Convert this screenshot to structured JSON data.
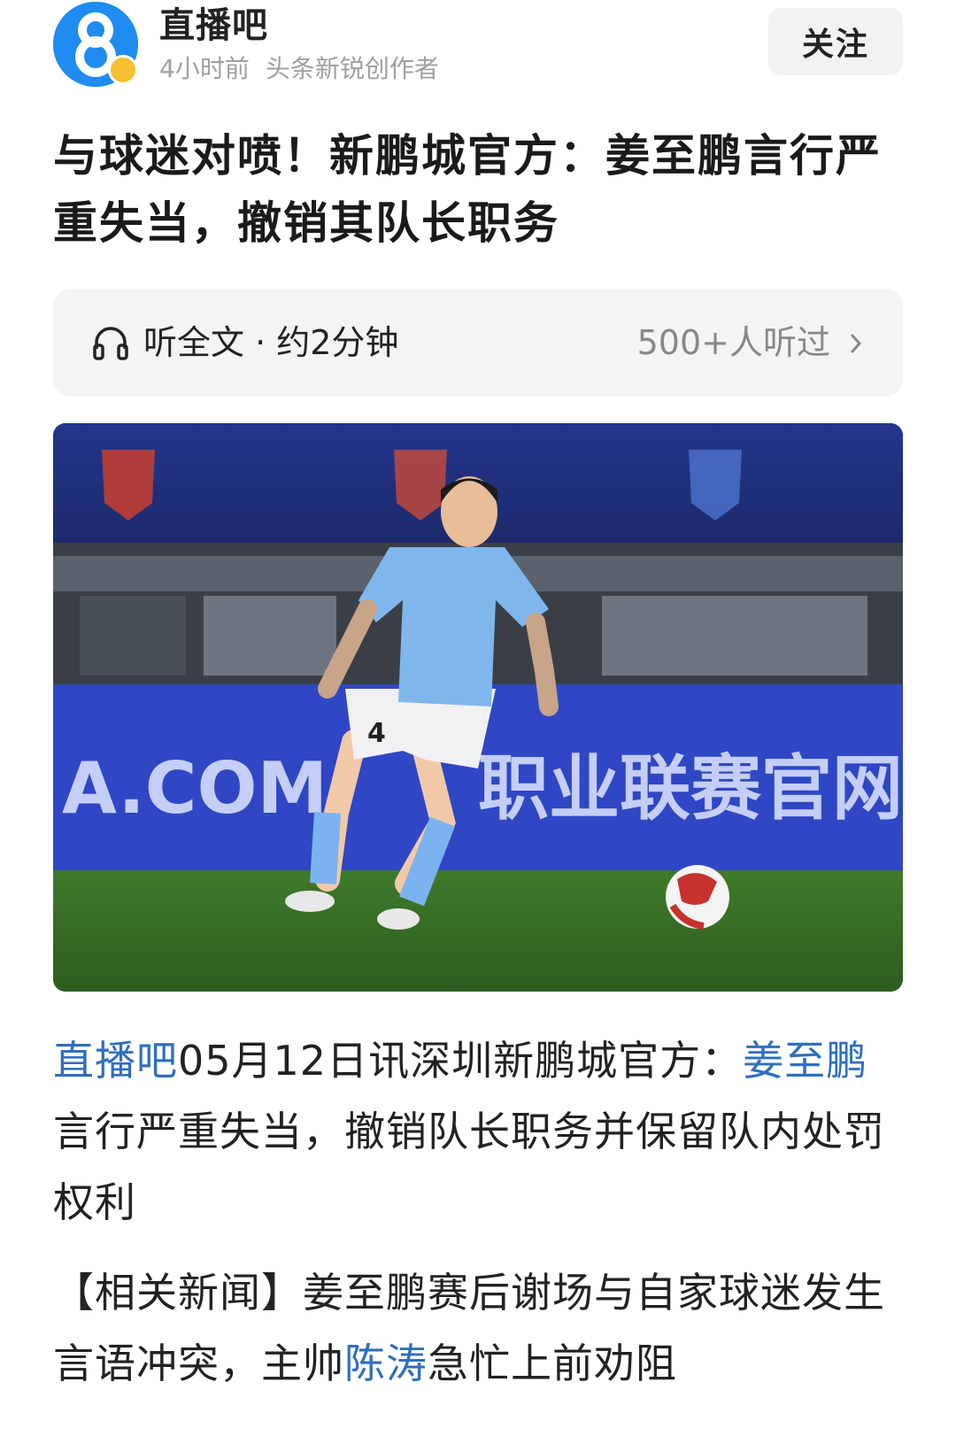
{
  "header": {
    "author_name": "直播吧",
    "time": "4小时前",
    "author_tag": "头条新锐创作者",
    "follow_label": "关注"
  },
  "article": {
    "title": "与球迷对喷！新鹏城官方：姜至鹏言行严重失当，撤销其队长职务"
  },
  "listen": {
    "label": "听全文 · 约2分钟",
    "count": "500+人听过"
  },
  "photo": {
    "banner_text_left": "A.COM",
    "banner_text_right": "职业联赛官网",
    "jersey_number": "4"
  },
  "body": {
    "p1_link1": "直播吧",
    "p1_text1": "05月12日讯深圳新鹏城官方：",
    "p1_link2": "姜至鹏",
    "p1_text2": "言行严重失当，撤销队长职务并保留队内处罚权利",
    "p2_text1": "【相关新闻】姜至鹏赛后谢场与自家球迷发生言语冲突，主帅",
    "p2_link": "陈涛",
    "p2_text2": "急忙上前劝阻"
  },
  "colors": {
    "link": "#2f6fbf",
    "avatar": "#1e8cf0",
    "badge": "#f6c030"
  }
}
